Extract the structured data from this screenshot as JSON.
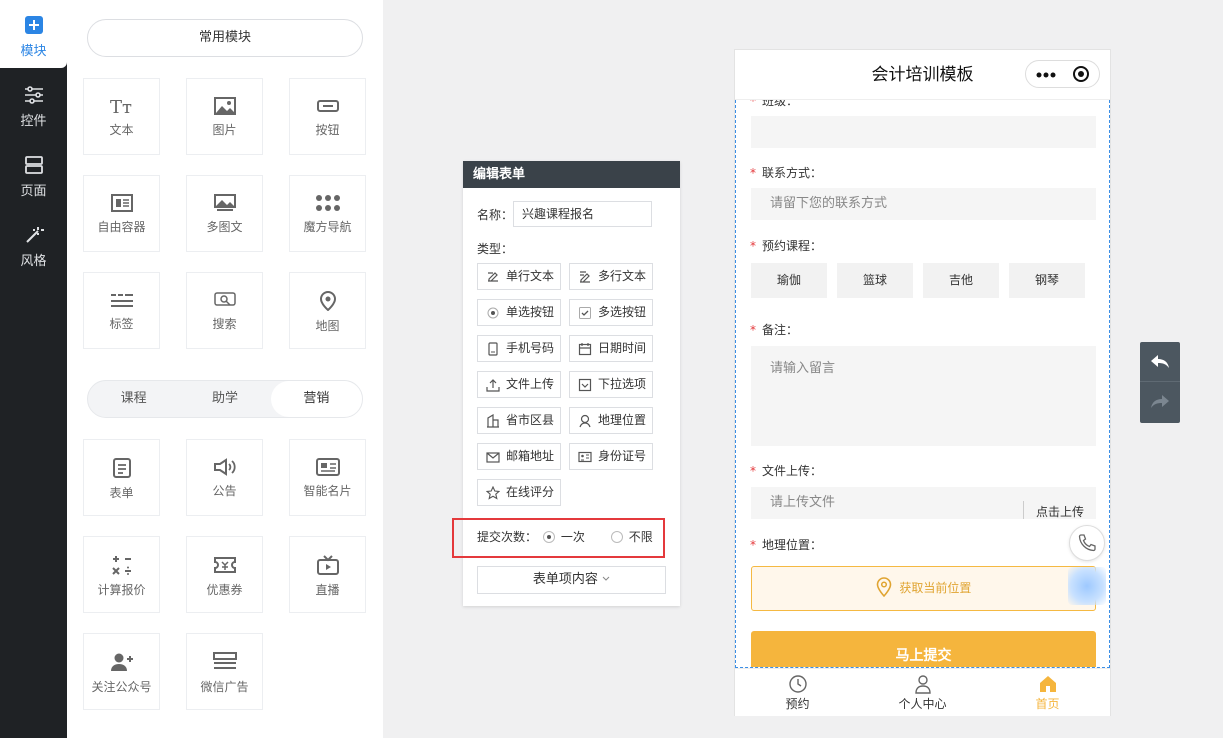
{
  "leftnav": {
    "items": [
      {
        "label": "模块",
        "icon": "plus-icon",
        "active": true
      },
      {
        "label": "控件",
        "icon": "sliders-icon",
        "active": false
      },
      {
        "label": "页面",
        "icon": "pages-icon",
        "active": false
      },
      {
        "label": "风格",
        "icon": "magic-wand-icon",
        "active": false
      }
    ]
  },
  "panel": {
    "common_label": "常用模块",
    "common_tiles": [
      {
        "label": "文本",
        "icon": "text-icon"
      },
      {
        "label": "图片",
        "icon": "image-icon"
      },
      {
        "label": "按钮",
        "icon": "button-icon"
      },
      {
        "label": "自由容器",
        "icon": "container-icon"
      },
      {
        "label": "多图文",
        "icon": "multi-image-icon"
      },
      {
        "label": "魔方导航",
        "icon": "grid-dots-icon"
      },
      {
        "label": "标签",
        "icon": "tag-icon"
      },
      {
        "label": "搜索",
        "icon": "search-icon"
      },
      {
        "label": "地图",
        "icon": "map-pin-icon"
      }
    ],
    "tabs": [
      {
        "label": "课程"
      },
      {
        "label": "助学"
      },
      {
        "label": "营销",
        "active": true
      }
    ],
    "market_tiles": [
      {
        "label": "表单",
        "icon": "form-icon"
      },
      {
        "label": "公告",
        "icon": "speaker-icon"
      },
      {
        "label": "智能名片",
        "icon": "card-icon"
      },
      {
        "label": "计算报价",
        "icon": "calculator-icon"
      },
      {
        "label": "优惠券",
        "icon": "coupon-icon"
      },
      {
        "label": "直播",
        "icon": "tv-icon"
      },
      {
        "label": "关注公众号",
        "icon": "follow-user-icon"
      },
      {
        "label": "微信广告",
        "icon": "ad-icon"
      }
    ]
  },
  "editor": {
    "title": "编辑表单",
    "name_label": "名称：",
    "name_value": "兴趣课程报名",
    "type_label": "类型：",
    "types": [
      {
        "label": "单行文本",
        "icon": "edit-line-icon"
      },
      {
        "label": "多行文本",
        "icon": "edit-multi-icon"
      },
      {
        "label": "单选按钮",
        "icon": "radio-icon"
      },
      {
        "label": "多选按钮",
        "icon": "checkbox-icon"
      },
      {
        "label": "手机号码",
        "icon": "phone-icon"
      },
      {
        "label": "日期时间",
        "icon": "calendar-icon"
      },
      {
        "label": "文件上传",
        "icon": "upload-icon"
      },
      {
        "label": "下拉选项",
        "icon": "dropdown-icon"
      },
      {
        "label": "省市区县",
        "icon": "building-icon"
      },
      {
        "label": "地理位置",
        "icon": "location-icon"
      },
      {
        "label": "邮箱地址",
        "icon": "mail-icon"
      },
      {
        "label": "身份证号",
        "icon": "id-card-icon"
      },
      {
        "label": "在线评分",
        "icon": "star-icon"
      }
    ],
    "submit_count_label": "提交次数：",
    "submit_once": "一次",
    "submit_unlimited": "不限",
    "content_btn": "表单项内容"
  },
  "phone": {
    "title": "会计培训模板",
    "fields": {
      "class_label": "班级：",
      "contact_label": "联系方式：",
      "contact_placeholder": "请留下您的联系方式",
      "course_label": "预约课程：",
      "courses": [
        "瑜伽",
        "篮球",
        "吉他",
        "钢琴"
      ],
      "note_label": "备注：",
      "note_placeholder": "请输入留言",
      "file_label": "文件上传：",
      "file_placeholder": "请上传文件",
      "upload_btn": "点击上传",
      "location_label": "地理位置：",
      "location_btn": "获取当前位置",
      "submit": "马上提交"
    },
    "tabbar": [
      {
        "label": "预约",
        "icon": "clock-icon"
      },
      {
        "label": "个人中心",
        "icon": "user-icon"
      },
      {
        "label": "首页",
        "icon": "home-icon",
        "active": true
      }
    ],
    "accent": "#f5b53d"
  }
}
